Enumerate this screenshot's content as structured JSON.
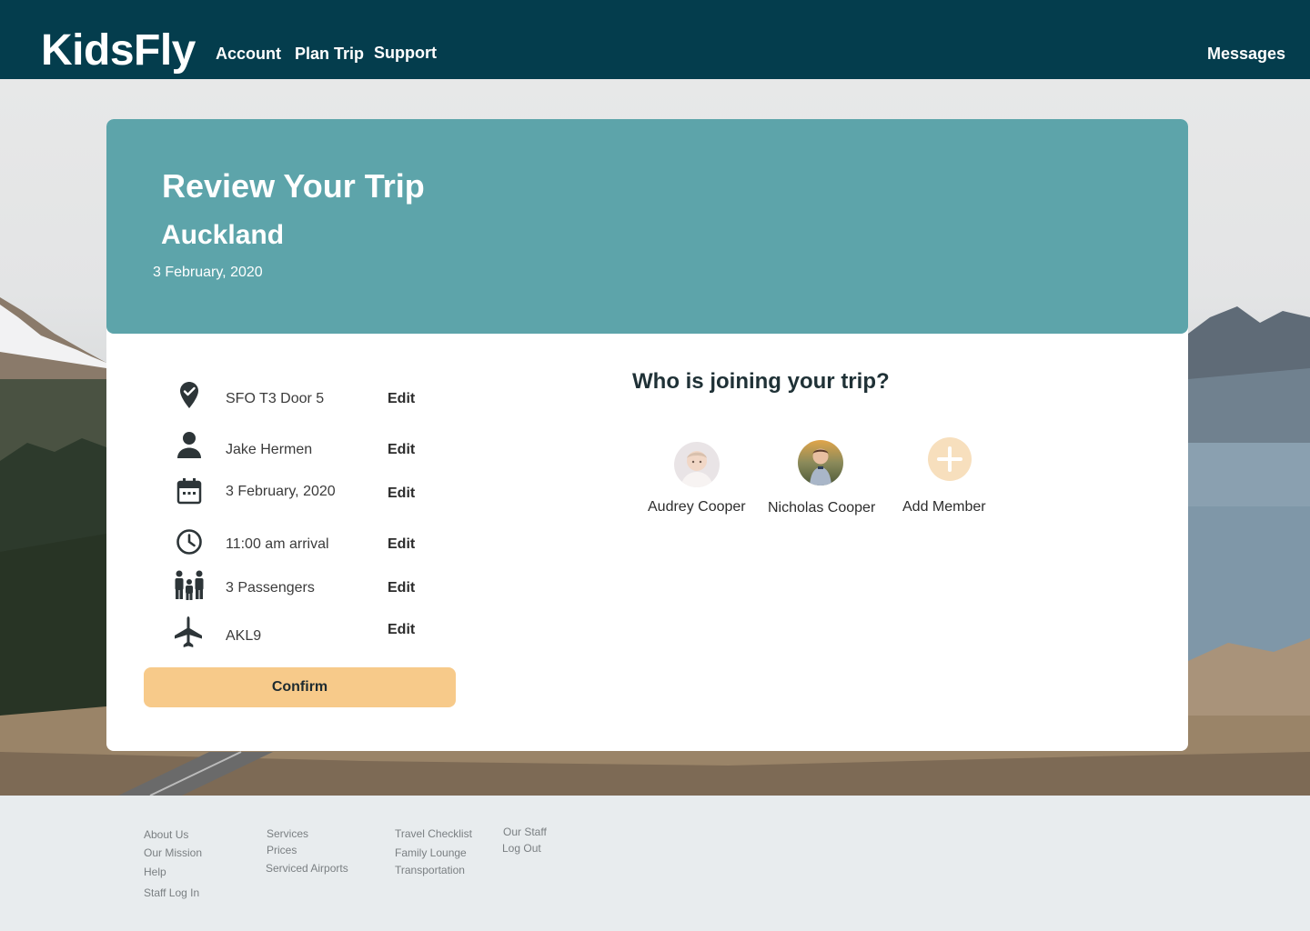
{
  "header": {
    "logo": "KidsFly",
    "nav": [
      "Account",
      "Plan Trip",
      "Support"
    ],
    "messages": "Messages"
  },
  "hero": {
    "title": "Review Your Trip",
    "city": "Auckland",
    "date": "3 February, 2020"
  },
  "details": [
    {
      "icon": "location-pin-icon",
      "text": "SFO T3 Door 5",
      "edit": "Edit"
    },
    {
      "icon": "person-icon",
      "text": "Jake Hermen",
      "edit": "Edit"
    },
    {
      "icon": "calendar-icon",
      "text": "3 February, 2020",
      "edit": "Edit"
    },
    {
      "icon": "clock-icon",
      "text": "11:00 am arrival",
      "edit": "Edit"
    },
    {
      "icon": "family-icon",
      "text": "3 Passengers",
      "edit": "Edit"
    },
    {
      "icon": "airplane-icon",
      "text": "AKL9",
      "edit": "Edit"
    }
  ],
  "confirm_label": "Confirm",
  "members": {
    "title": "Who is joining your trip?",
    "list": [
      {
        "name": "Audrey Cooper"
      },
      {
        "name": "Nicholas Cooper"
      }
    ],
    "add_label": "Add Member"
  },
  "footer": {
    "col1": [
      "About Us",
      "Our Mission",
      "Help",
      "Staff Log In"
    ],
    "col2": [
      "Services",
      "Prices",
      "Serviced Airports"
    ],
    "col3": [
      "Travel Checklist",
      "Family Lounge",
      "Transportation"
    ],
    "col4": [
      "Our Staff",
      "Log Out"
    ]
  },
  "colors": {
    "header_bg": "#043d4d",
    "hero_bg": "#5da4aa",
    "confirm_bg": "#f7ca8a",
    "add_member_bg": "#f7dfbd",
    "footer_bg": "#e8ecee"
  }
}
